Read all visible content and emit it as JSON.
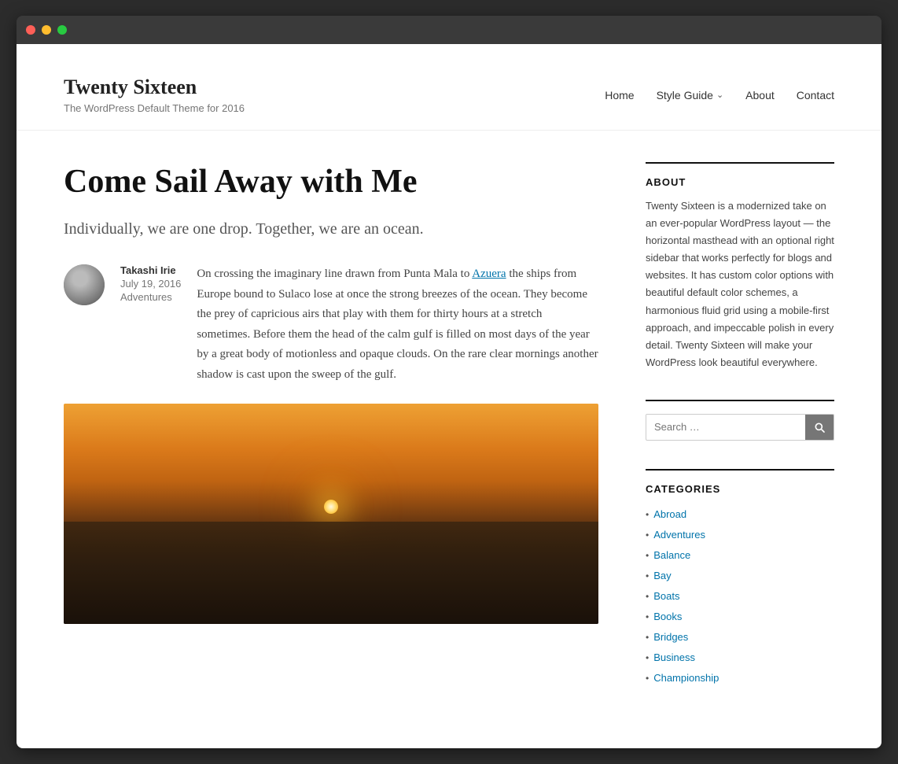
{
  "browser": {
    "dots": [
      "red",
      "yellow",
      "green"
    ]
  },
  "header": {
    "site_title": "Twenty Sixteen",
    "site_description": "The WordPress Default Theme for 2016",
    "nav": {
      "items": [
        {
          "label": "Home",
          "has_arrow": false
        },
        {
          "label": "Style Guide",
          "has_arrow": true
        },
        {
          "label": "About",
          "has_arrow": false
        },
        {
          "label": "Contact",
          "has_arrow": false
        }
      ]
    }
  },
  "post": {
    "title": "Come Sail Away with Me",
    "subtitle": "Individually, we are one drop. Together, we are an ocean.",
    "author": "Takashi Irie",
    "date": "July 19, 2016",
    "category": "Adventures",
    "body_before_link": "On crossing the imaginary line drawn from Punta Mala to ",
    "link_text": "Azuera",
    "body_after_link": " the ships from Europe bound to Sulaco lose at once the strong breezes of the ocean. They become the prey of capricious airs that play with them for thirty hours at a stretch sometimes. Before them the head of the calm gulf is filled on most days of the year by a great body of motionless and opaque clouds. On the rare clear mornings another shadow is cast upon the sweep of the gulf."
  },
  "sidebar": {
    "about": {
      "heading": "ABOUT",
      "text": "Twenty Sixteen is a modernized take on an ever-popular WordPress layout — the horizontal masthead with an optional right sidebar that works perfectly for blogs and websites. It has custom color options with beautiful default color schemes, a harmonious fluid grid using a mobile-first approach, and impeccable polish in every detail. Twenty Sixteen will make your WordPress look beautiful everywhere."
    },
    "search": {
      "placeholder": "Search …",
      "button_label": "Search"
    },
    "categories": {
      "heading": "CATEGORIES",
      "items": [
        "Abroad",
        "Adventures",
        "Balance",
        "Bay",
        "Boats",
        "Books",
        "Bridges",
        "Business",
        "Championship"
      ]
    }
  }
}
